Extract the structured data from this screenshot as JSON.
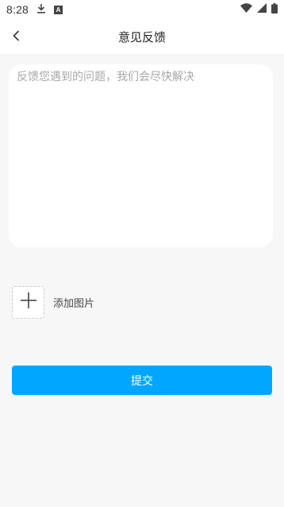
{
  "status_bar": {
    "time": "8:28",
    "left_icons": [
      "download-icon",
      "a-badge-icon"
    ],
    "a_badge_text": "A",
    "right_icons": [
      "wifi-icon",
      "signal-icon",
      "battery-icon"
    ]
  },
  "app_bar": {
    "title": "意见反馈",
    "back_icon": "back-arrow-icon"
  },
  "feedback": {
    "value": "",
    "placeholder": "反馈您遇到的问题，我们会尽快解决"
  },
  "add_image": {
    "icon": "plus-icon",
    "label": "添加图片"
  },
  "submit": {
    "label": "提交"
  },
  "colors": {
    "accent": "#00a6ff",
    "background": "#f7f7f7",
    "card": "#ffffff"
  }
}
